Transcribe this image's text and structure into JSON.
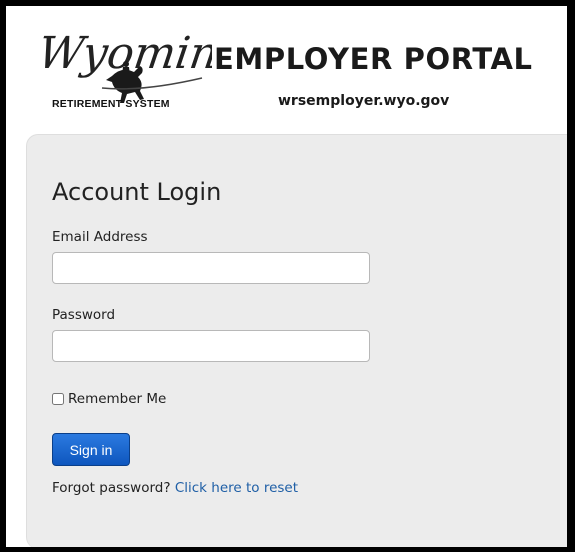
{
  "header": {
    "logo_script": "Wyoming",
    "logo_subtitle": "RETIREMENT SYSTEM",
    "portal_title": "EMPLOYER PORTAL",
    "portal_url": "wrsemployer.wyo.gov"
  },
  "login": {
    "heading": "Account Login",
    "email_label": "Email Address",
    "email_value": "",
    "password_label": "Password",
    "password_value": "",
    "remember_label": "Remember Me",
    "remember_checked": false,
    "signin_label": "Sign in",
    "forgot_text": "Forgot password?",
    "reset_link": "Click here to reset"
  },
  "colors": {
    "panel_bg": "#ececec",
    "button_bg": "#1565c8",
    "link": "#1f5fa6"
  }
}
